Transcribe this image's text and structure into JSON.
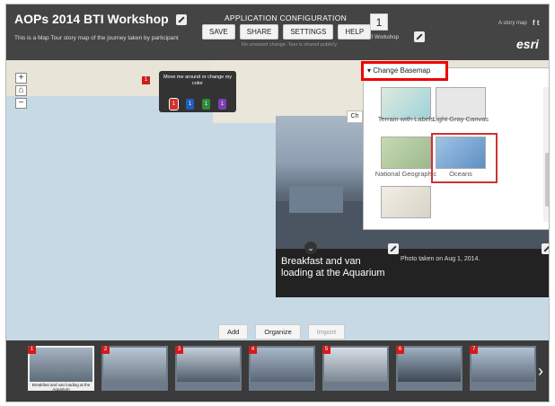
{
  "header": {
    "title": "AOPs 2014 BTI Workshop",
    "subtitle": "This is a Map Tour story map of the journey taken by participant",
    "config_title": "APPLICATION CONFIGURATION",
    "buttons": [
      "SAVE",
      "SHARE",
      "SETTINGS",
      "HELP"
    ],
    "status": "No unsaved change. Tour is shared publicly",
    "theme_number": "1",
    "theme_label": "TI Workshop",
    "story_link": "A story map",
    "social": "f  t",
    "esri_logo": "esri"
  },
  "map": {
    "zoom_in": "+",
    "home": "⌂",
    "zoom_out": "−",
    "pin_label": "1",
    "tooltip": "Move me around or change my color",
    "color_pins": [
      {
        "label": "1",
        "color": "#d32f2f"
      },
      {
        "label": "1",
        "color": "#1e5dbf"
      },
      {
        "label": "1",
        "color": "#2e8b3a"
      },
      {
        "label": "1",
        "color": "#7b3fb3"
      }
    ]
  },
  "basemap": {
    "header": "Change Basemap",
    "items": [
      {
        "label": "Terrain with Labels"
      },
      {
        "label": "Light Gray Canvas"
      },
      {
        "label": "National Geographic"
      },
      {
        "label": "Oceans"
      }
    ]
  },
  "photo": {
    "chip_label": "Ch",
    "caption": "Breakfast and van loading at the Aquarium",
    "date": "Photo taken on Aug 1, 2014."
  },
  "controls": {
    "add": "Add",
    "organize": "Organize",
    "import": "Import"
  },
  "carousel": {
    "slides": [
      {
        "num": "1",
        "caption": "Breakfast and van loading at the Aquarium",
        "tone": "#8796a6"
      },
      {
        "num": "2",
        "caption": "",
        "tone": "#7f8c99"
      },
      {
        "num": "3",
        "caption": "",
        "tone": "#6c7a89"
      },
      {
        "num": "4",
        "caption": "",
        "tone": "#8a99aa"
      },
      {
        "num": "5",
        "caption": "",
        "tone": "#9aa3ad"
      },
      {
        "num": "6",
        "caption": "",
        "tone": "#5f6b78"
      },
      {
        "num": "7",
        "caption": "",
        "tone": "#7d8fa3"
      }
    ],
    "next": "›"
  }
}
